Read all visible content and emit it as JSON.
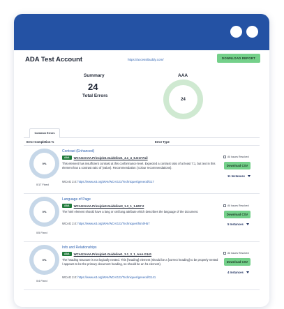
{
  "app": {
    "account_title": "ADA Test Account",
    "url": "https://accessibuddy.com/",
    "download_report_label": "DOWNLOAD REPORT",
    "brand_color": "#2452a4",
    "accent_color": "#74d08a"
  },
  "summary": {
    "label": "Summary",
    "total_errors": "24",
    "total_errors_label": "Total Errors",
    "level_label": "AAA",
    "level_value": "24"
  },
  "tabs": [
    {
      "label": "Common Errors"
    }
  ],
  "table": {
    "headers": [
      "Error Completion %",
      "Error Type"
    ],
    "rows": [
      {
        "completion": "0%",
        "fixed": "0/17 Fixed",
        "title": "Contrast (Enhanced)",
        "level": "AAA",
        "rule": "WCAG2AAA.Principle1.Guideline1_4.1_4_6.G17.Fail",
        "description": "This element has insufficient contrast at this conformance level. Expected a contrast ratio of at least 7:1, but text in this element has a contrast ratio of {value}. Recommendation: {colour recommendations}.",
        "wcag_prefix": "WCAG 2.0:",
        "wcag_link": "https://www.w3.org/WAI/WCAG21/Techniques/general/G17",
        "resolved_label": "All Issues Resolved",
        "csv_label": "Download CSV",
        "instances": "11 Instances"
      },
      {
        "completion": "0%",
        "fixed": "0/5 Fixed",
        "title": "Language of Page",
        "level": "AAA",
        "rule": "WCAG2AAA.Principle3.Guideline3_1.3_1_1.H57.2",
        "description": "The html element should have a lang or xml:lang attribute which describes the language of the document.",
        "wcag_prefix": "WCAG 2.0:",
        "wcag_link": "https://www.w3.org/WAI/WCAG21/Techniques/html/H57",
        "resolved_label": "All Issues Resolved",
        "csv_label": "Download CSV",
        "instances": "5 Instances"
      },
      {
        "completion": "0%",
        "fixed": "0/4 Fixed",
        "title": "Info and Relationships",
        "level": "AAA",
        "rule": "WCAG2AAA.Principle1.Guideline1_3.1_3_1_AAA.G141",
        "description": "The heading structure is not logically nested. This [heading] element (should be a [correct heading] to be properly nested / appears to be the primary document heading, so should be an h1 element).",
        "wcag_prefix": "WCAG 2.0:",
        "wcag_link": "https://www.w3.org/WAI/WCAG21/Techniques/general/G141",
        "resolved_label": "All Issues Resolved",
        "csv_label": "Download CSV",
        "instances": "4 Instances"
      }
    ]
  }
}
